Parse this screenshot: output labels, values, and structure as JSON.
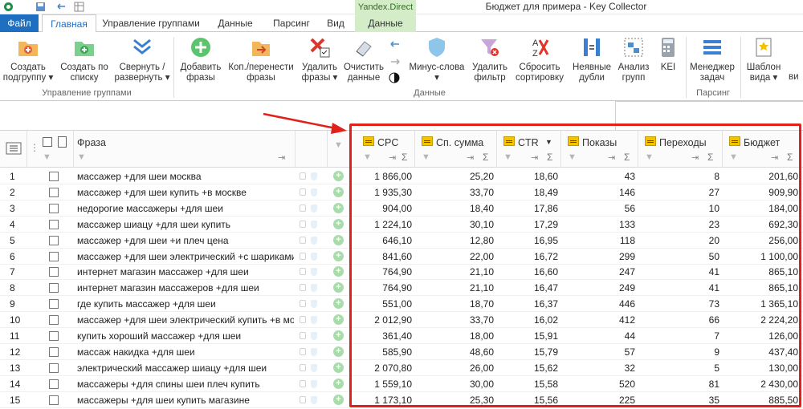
{
  "window": {
    "title": "Бюджет для примера - Key Collector",
    "context_title": "Yandex.Direct"
  },
  "tabs": [
    {
      "label": "Файл"
    },
    {
      "label": "Главная"
    },
    {
      "label": "Управление группами"
    },
    {
      "label": "Данные"
    },
    {
      "label": "Парсинг"
    },
    {
      "label": "Вид"
    },
    {
      "label": "Данные"
    }
  ],
  "ribbon": {
    "buttons": [
      {
        "label1": "Создать",
        "label2": "подгруппу",
        "icon": "folder-add-icon"
      },
      {
        "label1": "Создать по",
        "label2": "списку",
        "icon": "folder-list-icon"
      },
      {
        "label1": "Свернуть /",
        "label2": "развернуть",
        "icon": "collapse-chevrons-icon"
      },
      {
        "label1": "Добавить",
        "label2": "фразы",
        "icon": "add-circle-icon"
      },
      {
        "label1": "Коп./перенести",
        "label2": "фразы",
        "icon": "copy-move-icon"
      },
      {
        "label1": "Удалить",
        "label2": "фразы",
        "icon": "delete-x-icon"
      },
      {
        "label1": "Очистить",
        "label2": "данные",
        "icon": "eraser-icon"
      },
      {
        "label1": "Минус-слова",
        "label2": "",
        "icon": "shield-icon"
      },
      {
        "label1": "Удалить",
        "label2": "фильтр",
        "icon": "funnel-delete-icon"
      },
      {
        "label1": "Сбросить",
        "label2": "сортировку",
        "icon": "sort-reset-icon"
      },
      {
        "label1": "Неявные",
        "label2": "дубли",
        "icon": "duplicates-icon"
      },
      {
        "label1": "Анализ",
        "label2": "групп",
        "icon": "group-analysis-icon"
      },
      {
        "label1": "KEI",
        "label2": "",
        "icon": "calculator-icon"
      },
      {
        "label1": "Менеджер",
        "label2": "задач",
        "icon": "task-manager-icon"
      },
      {
        "label1": "Шаблон",
        "label2": "вида",
        "icon": "template-icon"
      },
      {
        "label1": "ви",
        "label2": "",
        "icon": ""
      }
    ],
    "groups": [
      {
        "label": "Управление группами"
      },
      {
        "label": "Данные"
      },
      {
        "label": "Парсинг"
      }
    ]
  },
  "grid": {
    "columns": {
      "phrase": "Фраза",
      "cpc": "CPC",
      "sum": "Сп. сумма",
      "ctr": "CTR",
      "shows": "Показы",
      "clicks": "Переходы",
      "budget": "Бюджет"
    },
    "rows": [
      {
        "n": "1",
        "phrase": "массажер +для шеи москва",
        "cpc": "1 866,00",
        "sum": "25,20",
        "ctr": "18,60",
        "shows": "43",
        "clicks": "8",
        "budget": "201,60"
      },
      {
        "n": "2",
        "phrase": "массажер +для шеи купить +в москве",
        "cpc": "1 935,30",
        "sum": "33,70",
        "ctr": "18,49",
        "shows": "146",
        "clicks": "27",
        "budget": "909,90"
      },
      {
        "n": "3",
        "phrase": "недорогие массажеры +для шеи",
        "cpc": "904,00",
        "sum": "18,40",
        "ctr": "17,86",
        "shows": "56",
        "clicks": "10",
        "budget": "184,00"
      },
      {
        "n": "4",
        "phrase": "массажер шиацу +для шеи купить",
        "cpc": "1 224,10",
        "sum": "30,10",
        "ctr": "17,29",
        "shows": "133",
        "clicks": "23",
        "budget": "692,30"
      },
      {
        "n": "5",
        "phrase": "массажер +для шеи +и плеч цена",
        "cpc": "646,10",
        "sum": "12,80",
        "ctr": "16,95",
        "shows": "118",
        "clicks": "20",
        "budget": "256,00"
      },
      {
        "n": "6",
        "phrase": "массажер +для шеи электрический +с шариками к",
        "cpc": "841,60",
        "sum": "22,00",
        "ctr": "16,72",
        "shows": "299",
        "clicks": "50",
        "budget": "1 100,00"
      },
      {
        "n": "7",
        "phrase": "интернет магазин массажер +для шеи",
        "cpc": "764,90",
        "sum": "21,10",
        "ctr": "16,60",
        "shows": "247",
        "clicks": "41",
        "budget": "865,10"
      },
      {
        "n": "8",
        "phrase": "интернет магазин массажеров +для шеи",
        "cpc": "764,90",
        "sum": "21,10",
        "ctr": "16,47",
        "shows": "249",
        "clicks": "41",
        "budget": "865,10"
      },
      {
        "n": "9",
        "phrase": "где купить массажер +для шеи",
        "cpc": "551,00",
        "sum": "18,70",
        "ctr": "16,37",
        "shows": "446",
        "clicks": "73",
        "budget": "1 365,10"
      },
      {
        "n": "10",
        "phrase": "массажер +для шеи электрический купить +в моск",
        "cpc": "2 012,90",
        "sum": "33,70",
        "ctr": "16,02",
        "shows": "412",
        "clicks": "66",
        "budget": "2 224,20"
      },
      {
        "n": "11",
        "phrase": "купить хороший массажер +для шеи",
        "cpc": "361,40",
        "sum": "18,00",
        "ctr": "15,91",
        "shows": "44",
        "clicks": "7",
        "budget": "126,00"
      },
      {
        "n": "12",
        "phrase": "массаж накидка +для шеи",
        "cpc": "585,90",
        "sum": "48,60",
        "ctr": "15,79",
        "shows": "57",
        "clicks": "9",
        "budget": "437,40"
      },
      {
        "n": "13",
        "phrase": "электрический массажер шиацу +для шеи",
        "cpc": "2 070,80",
        "sum": "26,00",
        "ctr": "15,62",
        "shows": "32",
        "clicks": "5",
        "budget": "130,00"
      },
      {
        "n": "14",
        "phrase": "массажеры +для спины шеи плеч купить",
        "cpc": "1 559,10",
        "sum": "30,00",
        "ctr": "15,58",
        "shows": "520",
        "clicks": "81",
        "budget": "2 430,00"
      },
      {
        "n": "15",
        "phrase": "массажеры +для шеи купить магазине",
        "cpc": "1 173,10",
        "sum": "25,30",
        "ctr": "15,56",
        "shows": "225",
        "clicks": "35",
        "budget": "885,50"
      }
    ]
  },
  "colors": {
    "file_tab": "#1f6fc1",
    "context_tab": "#d4ecc8",
    "highlight": "#e0211b",
    "column_badge": "#f4c400"
  }
}
